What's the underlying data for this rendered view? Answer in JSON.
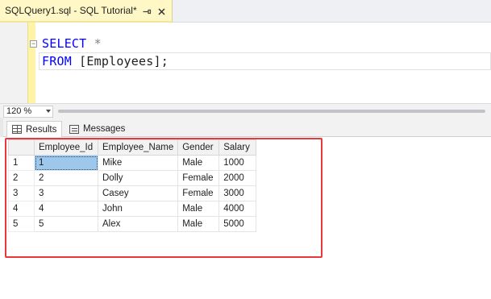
{
  "document_tab": {
    "title": "SQLQuery1.sql - SQL Tutorial*",
    "pin_icon": "pin-icon",
    "close_icon": "close-icon"
  },
  "editor": {
    "line1": {
      "keyword": "SELECT",
      "rest": " *"
    },
    "line2": {
      "keyword": "FROM",
      "rest": " [Employees];"
    }
  },
  "zoom": {
    "value": "120 %"
  },
  "results_tabs": [
    {
      "label": "Results",
      "icon": "grid-icon"
    },
    {
      "label": "Messages",
      "icon": "messages-icon"
    }
  ],
  "grid": {
    "columns": [
      "Employee_Id",
      "Employee_Name",
      "Gender",
      "Salary"
    ],
    "rows": [
      {
        "num": "1",
        "cells": [
          "1",
          "Mike",
          "Male",
          "1000"
        ]
      },
      {
        "num": "2",
        "cells": [
          "2",
          "Dolly",
          "Female",
          "2000"
        ]
      },
      {
        "num": "3",
        "cells": [
          "3",
          "Casey",
          "Female",
          "3000"
        ]
      },
      {
        "num": "4",
        "cells": [
          "4",
          "John",
          "Male",
          "4000"
        ]
      },
      {
        "num": "5",
        "cells": [
          "5",
          "Alex",
          "Male",
          "5000"
        ]
      }
    ]
  },
  "colors": {
    "keyword": "#0000ff",
    "highlight_box": "#e8383d",
    "selected_cell": "#9ec7ec",
    "tab_background": "#fff8c6"
  }
}
